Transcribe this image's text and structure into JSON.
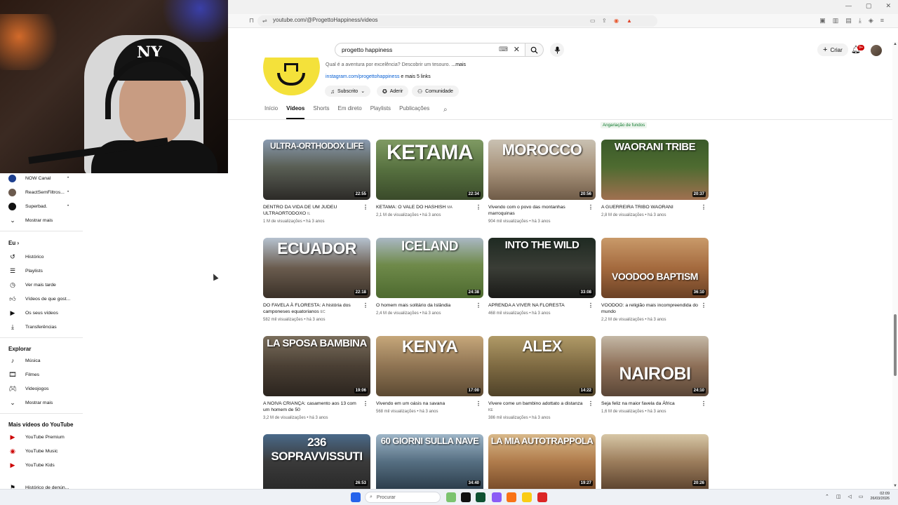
{
  "browser": {
    "url": "youtube.com/@ProgettoHappiness/videos",
    "window_controls": [
      "—",
      "▢",
      "✕"
    ]
  },
  "header": {
    "search_query": "progetto happiness",
    "create_label": "Criar",
    "notif_badge": "9+"
  },
  "sidebar": {
    "subscriptions": [
      {
        "label": "NOW Canal",
        "avatar_color": "#1d3f8f"
      },
      {
        "label": "ReactSemFiltros...",
        "avatar_color": "#6b5a4e"
      },
      {
        "label": "Superbad.",
        "avatar_color": "#111111"
      }
    ],
    "show_more_1": "Mostrar mais",
    "you_heading": "Eu",
    "you_items": [
      "Histórico",
      "Playlists",
      "Ver mais tarde",
      "Vídeos de que gost...",
      "Os seus vídeos",
      "Transferências"
    ],
    "explore_heading": "Explorar",
    "explore_items": [
      "Música",
      "Filmes",
      "Videojogos"
    ],
    "show_more_2": "Mostrar mais",
    "more_heading": "Mais vídeos do YouTube",
    "more_items": [
      "YouTube Premium",
      "YouTube Music",
      "YouTube Kids"
    ],
    "cut_item": "Histórico de denún..."
  },
  "channel": {
    "description": "Qual é a aventura por excelência? Descobrir um tesouro.",
    "more": "...mais",
    "link": "instagram.com/progettohappiness",
    "more_links": "e mais 5 links",
    "subscribed_label": "Subscrito",
    "join_label": "Aderir",
    "community_label": "Comunidade",
    "tabs": [
      "Início",
      "Vídeos",
      "Shorts",
      "Em direto",
      "Playlists",
      "Publicações"
    ],
    "funding_badge": "Angariação de fundos",
    "partial_label": "Angariação de fundos"
  },
  "videos": [
    {
      "thumb_text": "ULTRA-ORTHODOX LIFE",
      "duration": "22:55",
      "title": "DENTRO DA VIDA DE UM JUDEU ULTRAORTODOXO",
      "suffix": "IL",
      "views": "1 M de visualizações • há 3 anos"
    },
    {
      "thumb_text": "KETAMA",
      "duration": "22:34",
      "title": "KETAMA: O VALE DO HASHISH",
      "suffix": "MA",
      "views": "2,1 M de visualizações • há 3 anos"
    },
    {
      "thumb_text": "MOROCCO",
      "duration": "20:56",
      "title": "Vivendo com o povo das montanhas marroquinas",
      "suffix": "",
      "views": "904 mil visualizações • há 3 anos"
    },
    {
      "thumb_text": "WAORANI TRIBE",
      "duration": "20:37",
      "title": "A GUERREIRA TRIBO WAORANI",
      "suffix": "",
      "views": "2,8 M de visualizações • há 3 anos"
    },
    {
      "thumb_text": "ECUADOR",
      "duration": "22:18",
      "title": "DO FAVELA À FLORESTA: A história dos camponeses equatorianos",
      "suffix": "EC",
      "views": "582 mil visualizações • há 3 anos"
    },
    {
      "thumb_text": "ICELAND",
      "duration": "24:38",
      "title": "O homem mais solitário da Islândia",
      "suffix": "",
      "views": "2,4 M de visualizações • há 3 anos"
    },
    {
      "thumb_text": "INTO THE WILD",
      "duration": "33:08",
      "title": "APRENDA A VIVER NA FLORESTA",
      "suffix": "",
      "views": "468 mil visualizações • há 3 anos"
    },
    {
      "thumb_text": "VOODOO BAPTISM",
      "duration": "36:10",
      "title": "VOODOO: a religião mais incompreendida do mundo",
      "suffix": "",
      "views": "2,2 M de visualizações • há 3 anos"
    },
    {
      "thumb_text": "LA SPOSA BAMBINA",
      "duration": "19:06",
      "title": "A NOIVA CRIANÇA: casamento aos 13 com um homem de 50",
      "suffix": "",
      "views": "3,2 M de visualizações • há 3 anos"
    },
    {
      "thumb_text": "KENYA",
      "duration": "17:00",
      "title": "Vivendo em um oásis na savana",
      "suffix": "",
      "views": "568 mil visualizações • há 3 anos"
    },
    {
      "thumb_text": "ALEX",
      "duration": "14:22",
      "title": "Vivere come un bambino adottato a distanza",
      "suffix": "KE",
      "views": "386 mil visualizações • há 3 anos"
    },
    {
      "thumb_text": "NAIROBI",
      "duration": "24:10",
      "title": "Seja feliz na maior favela da África",
      "suffix": "",
      "views": "1,6 M de visualizações • há 3 anos"
    },
    {
      "thumb_text": "236 SOPRAVVISSUTI",
      "duration": "26:53",
      "title": "",
      "suffix": "",
      "views": ""
    },
    {
      "thumb_text": "60 GIORNI SULLA NAVE",
      "duration": "34:40",
      "title": "",
      "suffix": "",
      "views": ""
    },
    {
      "thumb_text": "LA MIA AUTOTRAPPOLA",
      "duration": "19:27",
      "title": "",
      "suffix": "",
      "views": ""
    },
    {
      "thumb_text": "",
      "duration": "20:26",
      "title": "",
      "suffix": "",
      "views": ""
    }
  ],
  "taskbar": {
    "search_placeholder": "Procurar",
    "time": "02:09",
    "date": "26/03/2026"
  },
  "colors": {
    "accent_red": "#cc0000",
    "link_blue": "#065fd4",
    "funding_green": "#0f7a2e"
  }
}
